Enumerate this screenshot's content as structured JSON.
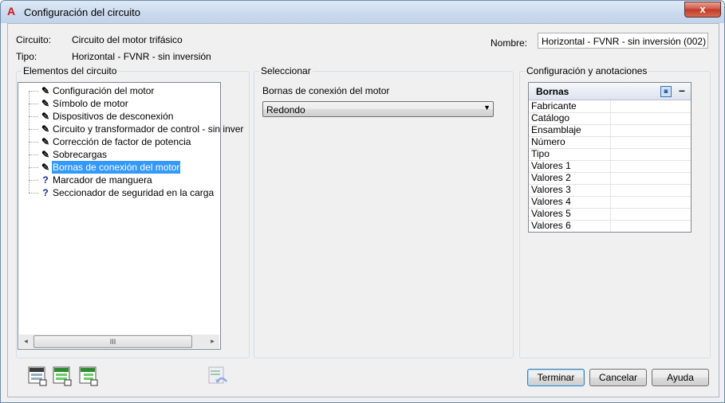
{
  "window": {
    "title": "Configuración del circuito",
    "icon": "autocad-a-icon",
    "close_label": "x"
  },
  "header": {
    "circuit_label": "Circuito:",
    "circuit_value": "Circuito del motor trifásico",
    "type_label": "Tipo:",
    "type_value": "Horizontal - FVNR - sin inversión",
    "name_label": "Nombre:",
    "name_value": "Horizontal - FVNR - sin inversión (002)"
  },
  "elements": {
    "title": "Elementos del circuito",
    "items": [
      {
        "label": "Configuración del motor",
        "icon": "pencil-icon",
        "selected": false
      },
      {
        "label": "Símbolo de motor",
        "icon": "pencil-icon",
        "selected": false
      },
      {
        "label": "Dispositivos de desconexión",
        "icon": "pencil-icon",
        "selected": false
      },
      {
        "label": "Circuito y transformador de control - sin inver",
        "icon": "pencil-icon",
        "selected": false
      },
      {
        "label": "Corrección de factor de potencia",
        "icon": "pencil-icon",
        "selected": false
      },
      {
        "label": "Sobrecargas",
        "icon": "pencil-icon",
        "selected": false
      },
      {
        "label": "Bornas de conexión del motor",
        "icon": "pencil-icon",
        "selected": true
      },
      {
        "label": "Marcador de manguera",
        "icon": "question-icon",
        "selected": false
      },
      {
        "label": "Seccionador de seguridad en la carga",
        "icon": "question-icon",
        "selected": false
      }
    ],
    "scroll_left": "◂",
    "scroll_right": "▸",
    "scroll_thumb": "III"
  },
  "select": {
    "title": "Seleccionar",
    "field_label": "Bornas de conexión del motor",
    "field_value": "Redondo"
  },
  "annotations": {
    "title": "Configuración y anotaciones",
    "grid_title": "Bornas",
    "collapse_label": "–",
    "rows": [
      "Fabricante",
      "Catálogo",
      "Ensamblaje",
      "Número",
      "Tipo",
      "Valores 1",
      "Valores 2",
      "Valores 3",
      "Valores 4",
      "Valores 5",
      "Valores 6"
    ]
  },
  "footer": {
    "finish_label": "Terminar",
    "cancel_label": "Cancelar",
    "help_label": "Ayuda"
  },
  "colors": {
    "selection": "#3399ff",
    "titlebar": "#c9d9ed",
    "close": "#c03a2b"
  }
}
